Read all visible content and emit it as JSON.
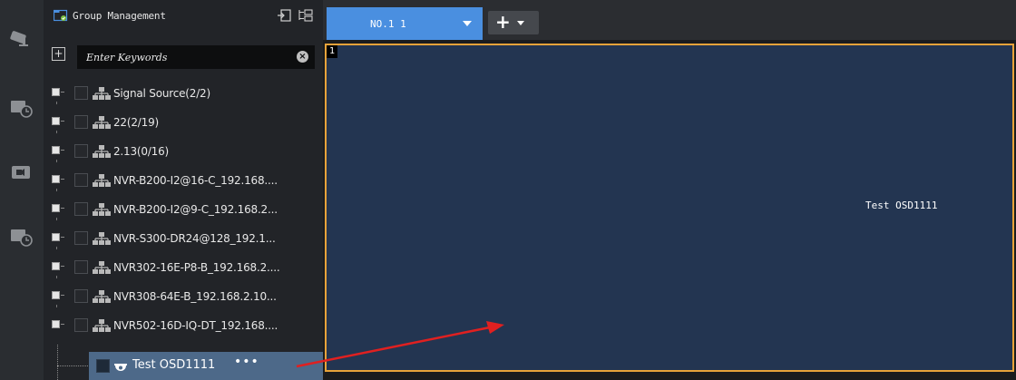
{
  "panel": {
    "title": "Group Management",
    "search_placeholder": "Enter Keywords",
    "add_symbol": "+",
    "clear_symbol": "×"
  },
  "tree": {
    "groups": [
      {
        "label": "Signal Source(2/2)"
      },
      {
        "label": "22(2/19)"
      },
      {
        "label": "2.13(0/16)"
      },
      {
        "label": "NVR-B200-I2@16-C_192.168...."
      },
      {
        "label": "NVR-B200-I2@9-C_192.168.2..."
      },
      {
        "label": "NVR-S300-DR24@128_192.1..."
      },
      {
        "label": "NVR302-16E-P8-B_192.168.2...."
      },
      {
        "label": "NVR308-64E-B_192.168.2.10..."
      },
      {
        "label": "NVR502-16D-IQ-DT_192.168...."
      }
    ],
    "selected_child": {
      "label": "Test OSD1111",
      "more": "•••"
    }
  },
  "main": {
    "active_tab": "NO.1 1",
    "add_label": "+",
    "window_index": "1",
    "osd_text": "Test OSD1111"
  },
  "colors": {
    "accent": "#4a8fe0",
    "selection": "#4d6989",
    "window_border": "#e8a33a",
    "window_bg": "#233551",
    "annotation_arrow": "#e02020"
  },
  "icons": {
    "rail": [
      "camera-icon",
      "playback-icon",
      "video-wall-icon",
      "playback-icon"
    ],
    "header": [
      "collapse-icon",
      "expand-icon"
    ],
    "group": "device-group-icon",
    "camera": "dome-camera-icon"
  }
}
